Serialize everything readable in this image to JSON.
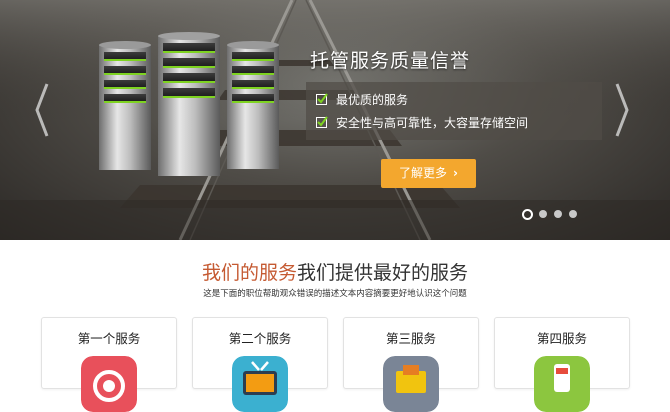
{
  "hero": {
    "headline": "托管服务质量信誉",
    "features": [
      "最优质的服务",
      "安全性与高可靠性，大容量存储空间"
    ],
    "cta_label": "了解更多",
    "slide_count": 4,
    "active_slide": 1
  },
  "services_section": {
    "title_accent": "我们的服务",
    "title_rest": "我们提供最好的服务",
    "subtitle": "这是下面的职位帮助观众错误的描述文本内容摘要更好地认识这个问题",
    "cards": [
      {
        "title": "第一个服务",
        "icon": "target-icon",
        "color": "#e8505b"
      },
      {
        "title": "第二个服务",
        "icon": "tv-icon",
        "color": "#3bb0d0"
      },
      {
        "title": "第三服务",
        "icon": "folder-icon",
        "color": "#7a8596"
      },
      {
        "title": "第四服务",
        "icon": "phone-icon",
        "color": "#8cc63f"
      }
    ]
  },
  "colors": {
    "accent": "#c55a32",
    "button": "#f3a72e",
    "server_led": "#7ed321"
  }
}
